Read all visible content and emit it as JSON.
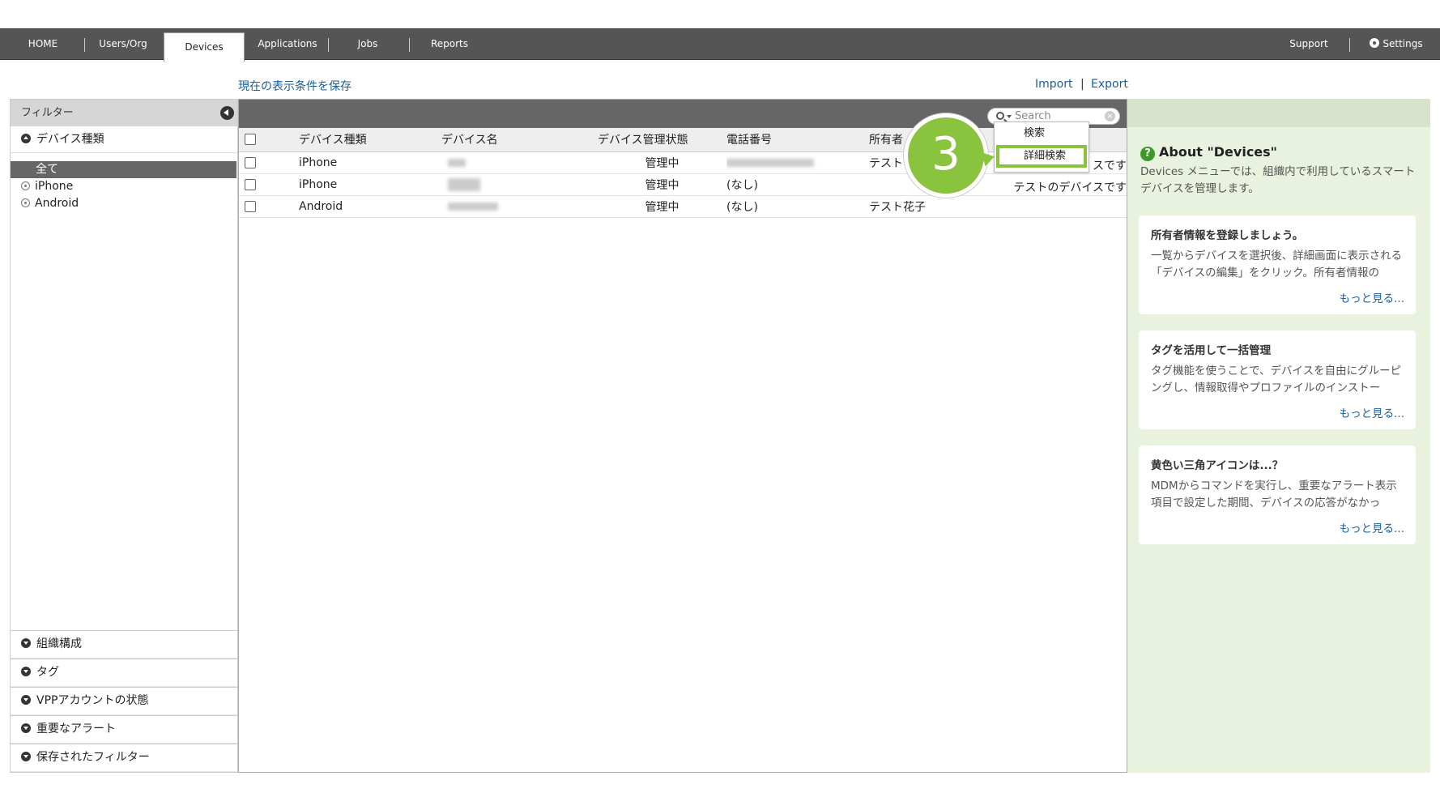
{
  "nav": {
    "tabs": [
      "HOME",
      "Users/Org",
      "Devices",
      "Applications",
      "Jobs",
      "Reports"
    ],
    "active": "Devices",
    "support": "Support",
    "settings": "Settings"
  },
  "links": {
    "save_view": "現在の表示条件を保存",
    "import": "Import",
    "separator": "|",
    "export": "Export"
  },
  "filter": {
    "header": "フィルター",
    "device_type": {
      "title": "デバイス種類",
      "items": [
        "全て",
        "iPhone",
        "Android"
      ],
      "selected": "全て"
    },
    "sections": [
      "組織構成",
      "タグ",
      "VPPアカウントの状態",
      "重要なアラート",
      "保存されたフィルター"
    ]
  },
  "search": {
    "placeholder": "Search",
    "menu": [
      "検索",
      "詳細検索"
    ]
  },
  "table": {
    "headers": [
      "デバイス種類",
      "デバイス名",
      "デバイス管理状態",
      "電話番号",
      "所有者"
    ],
    "rows": [
      {
        "type": "iPhone",
        "status": "管理中",
        "phone": "",
        "owner": "テスト",
        "note": "スです"
      },
      {
        "type": "iPhone",
        "status": "管理中",
        "phone": "(なし)",
        "owner": "",
        "note": "テストのデバイスです"
      },
      {
        "type": "Android",
        "status": "管理中",
        "phone": "(なし)",
        "owner": "テスト花子",
        "note": ""
      }
    ]
  },
  "step": "3",
  "help": {
    "title": "About \"Devices\"",
    "description": "Devices メニューでは、組織内で利用しているスマートデバイスを管理します。",
    "cards": [
      {
        "title": "所有者情報を登録しましょう。",
        "body": "一覧からデバイスを選択後、詳細画面に表示される「デバイスの編集」をクリック。所有者情報の",
        "more": "もっと見る..."
      },
      {
        "title": "タグを活用して一括管理",
        "body": "タグ機能を使うことで、デバイスを自由にグルーピングし、情報取得やプロファイルのインストー",
        "more": "もっと見る..."
      },
      {
        "title": "黄色い三角アイコンは...？",
        "body": "MDMからコマンドを実行し、重要なアラート表示項目で設定した期間、デバイスの応答がなかっ",
        "more": "もっと見る..."
      }
    ]
  },
  "colors": {
    "nav_bg": "#555555",
    "accent_green": "#8ac33e",
    "link_blue": "#1a5d9b",
    "help_bg": "#e8f2de"
  }
}
